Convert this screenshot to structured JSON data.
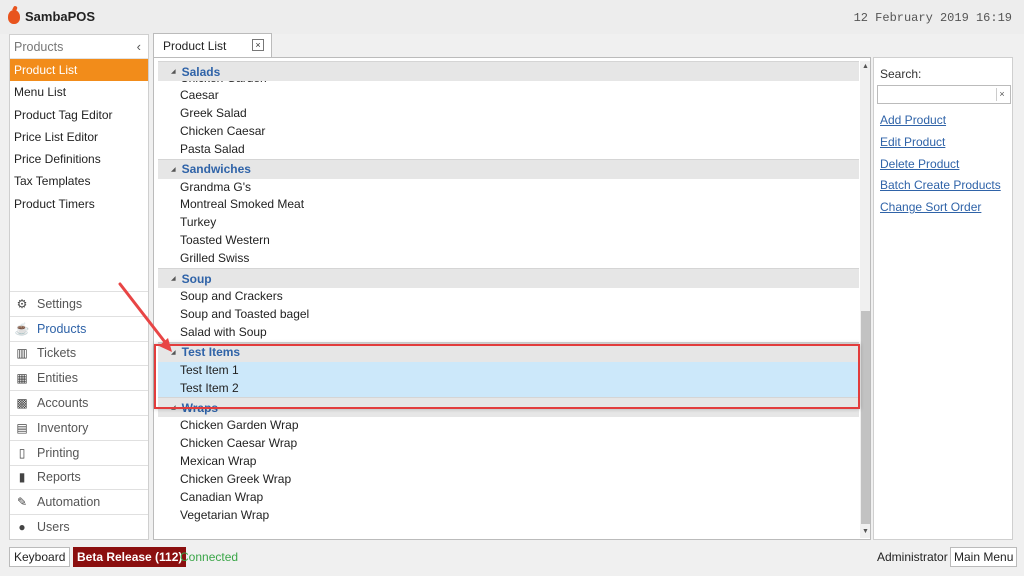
{
  "app": {
    "name": "SambaPOS",
    "datetime": "12 February 2019 16:19"
  },
  "leftnav": {
    "header": "Products",
    "collapse_glyph": "‹",
    "subitems": [
      {
        "label": "Product List",
        "active": true
      },
      {
        "label": "Menu List"
      },
      {
        "label": "Product Tag Editor"
      },
      {
        "label": "Price List Editor"
      },
      {
        "label": "Price Definitions"
      },
      {
        "label": "Tax Templates"
      },
      {
        "label": "Product Timers"
      }
    ],
    "modules": [
      {
        "label": "Settings",
        "icon": "gear-icon"
      },
      {
        "label": "Products",
        "icon": "cup-icon",
        "active": true
      },
      {
        "label": "Tickets",
        "icon": "tickets-icon"
      },
      {
        "label": "Entities",
        "icon": "entities-icon"
      },
      {
        "label": "Accounts",
        "icon": "calculator-icon"
      },
      {
        "label": "Inventory",
        "icon": "inventory-icon"
      },
      {
        "label": "Printing",
        "icon": "document-icon"
      },
      {
        "label": "Reports",
        "icon": "bar-chart-icon"
      },
      {
        "label": "Automation",
        "icon": "pen-icon"
      },
      {
        "label": "Users",
        "icon": "user-icon"
      }
    ]
  },
  "tab": {
    "label": "Product List",
    "close": "×"
  },
  "product_groups": [
    {
      "name": "Salads",
      "partial_item": "Chicken Garden",
      "items": [
        "Caesar",
        "Greek Salad",
        "Chicken Caesar",
        "Pasta Salad"
      ]
    },
    {
      "name": "Sandwiches",
      "items": [
        "Grandma G's",
        "Montreal Smoked Meat",
        "Turkey",
        "Toasted Western",
        "Grilled Swiss"
      ]
    },
    {
      "name": "Soup",
      "items": [
        "Soup and Crackers",
        "Soup and Toasted bagel",
        "Salad with Soup"
      ]
    },
    {
      "name": "Test Items",
      "items": [
        "Test Item 1",
        "Test Item 2"
      ],
      "selected": true
    },
    {
      "name": "Wraps",
      "items": [
        "Chicken Garden Wrap",
        "Chicken Caesar Wrap",
        "Mexican Wrap",
        "Chicken Greek Wrap",
        "Canadian Wrap",
        "Vegetarian Wrap"
      ]
    }
  ],
  "search": {
    "label": "Search:",
    "value": "",
    "clear": "×"
  },
  "actions": [
    "Add Product",
    "Edit Product",
    "Delete Product",
    "Batch Create Products",
    "Change Sort Order"
  ],
  "statusbar": {
    "keyboard": "Keyboard",
    "release": "Beta Release (112)",
    "connection": "Connected",
    "user": "Administrator",
    "main_menu": "Main Menu"
  },
  "colors": {
    "accent_orange": "#f28c1a",
    "link_blue": "#2f63a8",
    "selection": "#cce8fa",
    "annotation_red": "#e23c3c",
    "beta_red": "#8b0f0f",
    "connected_green": "#3aa648"
  }
}
